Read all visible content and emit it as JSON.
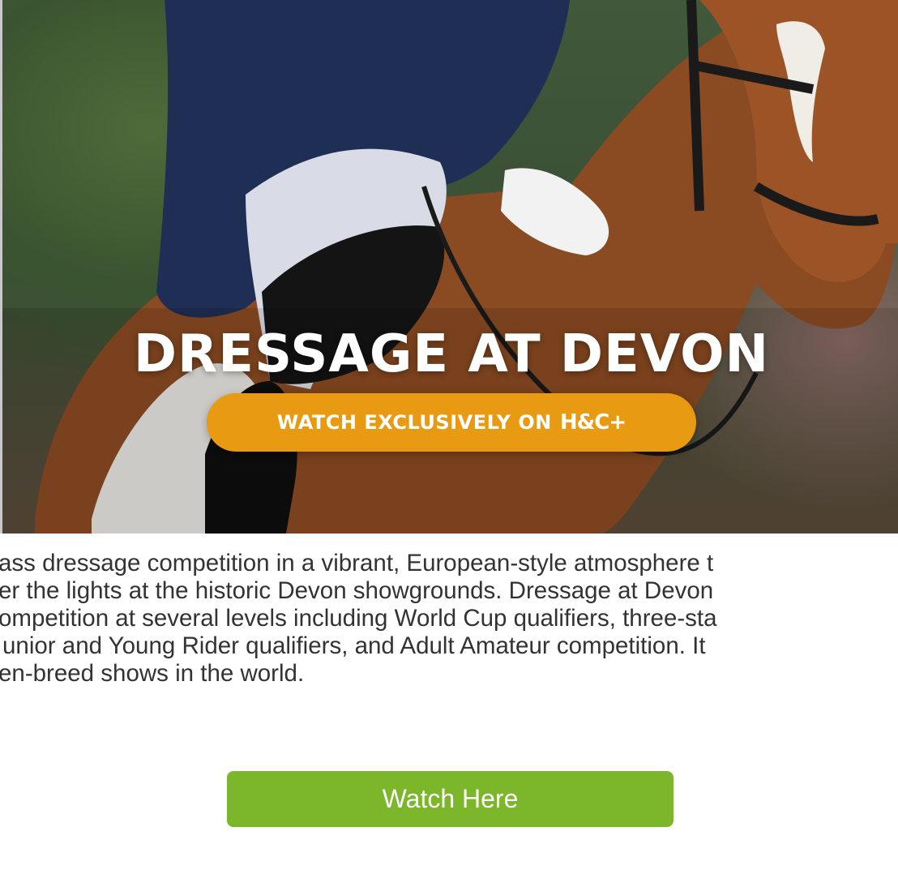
{
  "hero": {
    "title": "DRESSAGE AT DEVON",
    "cta_label": "WATCH EXCLUSIVELY ON",
    "cta_brand": "H&C+"
  },
  "description": {
    "lines": [
      "ass dressage competition in a vibrant, European-style atmosphere t",
      "er the lights at the historic Devon showgrounds. Dressage at Devon",
      "ompetition at several levels including World Cup qualifiers, three-sta",
      "unior and Young Rider qualifiers, and Adult Amateur competition. It",
      "en-breed shows in the world."
    ]
  },
  "watch_button": {
    "label": "Watch Here"
  },
  "colors": {
    "cta_orange": "#e79a12",
    "watch_green": "#7bb62b",
    "text": "#333333"
  }
}
